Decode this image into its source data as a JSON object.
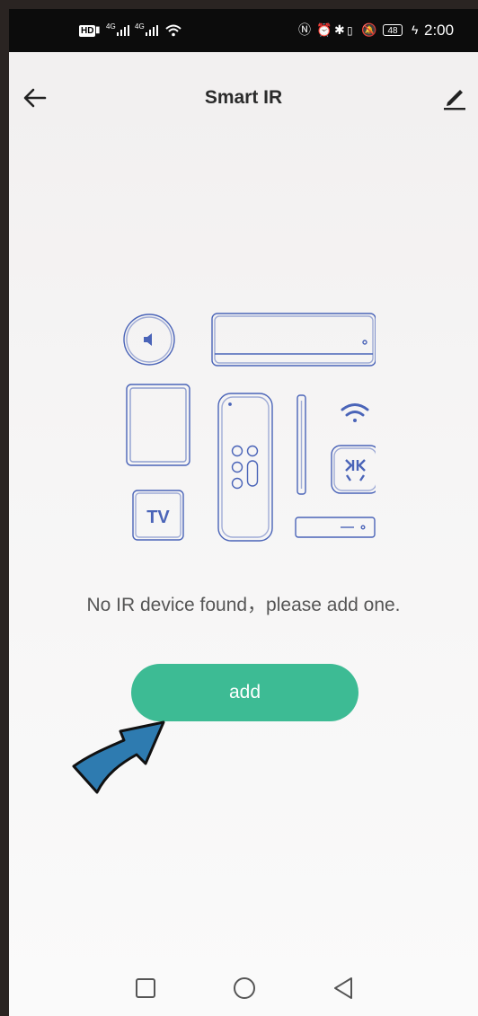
{
  "status_bar": {
    "hd_label": "HD",
    "net1": "4G",
    "net2": "4G",
    "battery": "48",
    "time": "2:00"
  },
  "header": {
    "title": "Smart IR"
  },
  "illustration": {
    "tv_label": "TV"
  },
  "main": {
    "empty_message": "No IR device found，please add one.",
    "add_button_label": "add"
  },
  "colors": {
    "accent": "#3dbb94",
    "illustration_stroke": "#4a64b8",
    "annotation_arrow": "#2e7bb0"
  },
  "icons": {
    "back": "arrow-left-icon",
    "edit": "pencil-icon",
    "nav_recent": "square-icon",
    "nav_home": "circle-icon",
    "nav_back": "triangle-back-icon"
  }
}
